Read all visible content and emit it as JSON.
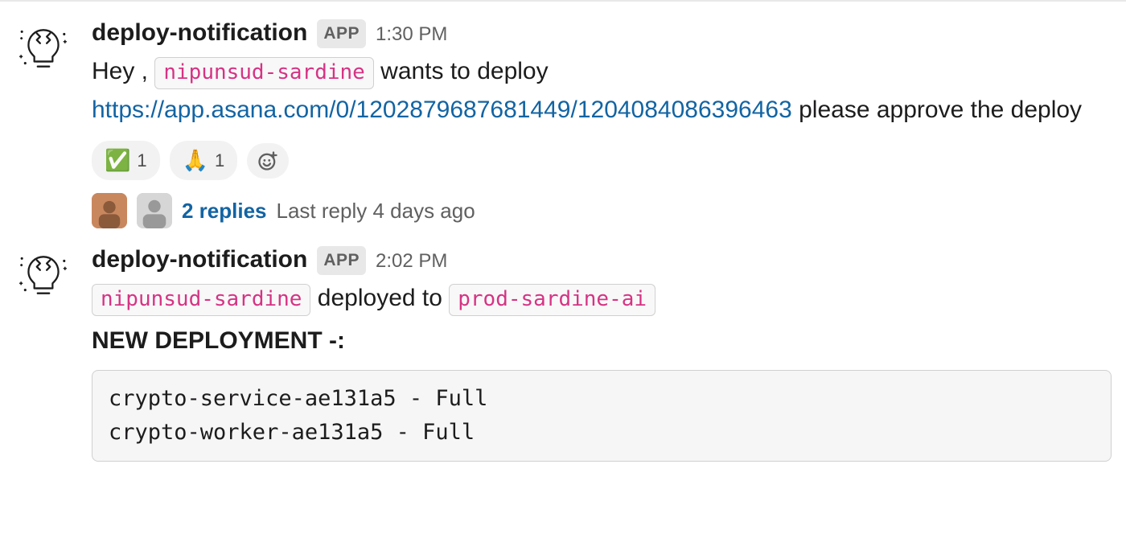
{
  "messages": [
    {
      "sender": "deploy-notification",
      "badge": "APP",
      "time": "1:30 PM",
      "body": {
        "prefix": "Hey , ",
        "user_token": "nipunsud-sardine",
        "mid": " wants to deploy ",
        "link": "https://app.asana.com/0/1202879687681449/1204084086396463",
        "suffix": " please approve the deploy"
      },
      "reactions": [
        {
          "emoji": "✅",
          "count": "1"
        },
        {
          "emoji": "🙏",
          "count": "1"
        }
      ],
      "thread": {
        "replies_label": "2 replies",
        "last_reply": "Last reply 4 days ago"
      }
    },
    {
      "sender": "deploy-notification",
      "badge": "APP",
      "time": "2:02 PM",
      "body2": {
        "user_token": "nipunsud-sardine",
        "mid": " deployed to ",
        "target_token": "prod-sardine-ai"
      },
      "heading": "NEW DEPLOYMENT -:",
      "code": "crypto-service-ae131a5 - Full\ncrypto-worker-ae131a5 - Full"
    }
  ]
}
